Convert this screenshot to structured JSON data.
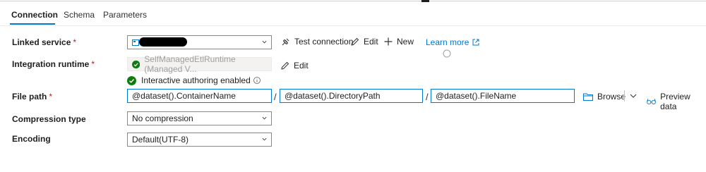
{
  "tabs": [
    {
      "label": "Connection"
    },
    {
      "label": "Schema"
    },
    {
      "label": "Parameters"
    }
  ],
  "linked_service": {
    "label": "Linked service",
    "required_mark": "*",
    "test_connection": "Test connection",
    "edit": "Edit",
    "new": "New",
    "learn_more": "Learn more"
  },
  "integration_runtime": {
    "label": "Integration runtime",
    "required_mark": "*",
    "value": "SelfManagedEtlRuntime (Managed V...",
    "edit": "Edit",
    "status": "Interactive authoring enabled"
  },
  "file_path": {
    "label": "File path",
    "required_mark": "*",
    "container": "@dataset().ContainerName",
    "directory": "@dataset().DirectoryPath",
    "file": "@dataset().FileName",
    "separator": "/",
    "browse": "Browse",
    "preview": "Preview data"
  },
  "compression": {
    "label": "Compression type",
    "value": "No compression"
  },
  "encoding": {
    "label": "Encoding",
    "value": "Default(UTF-8)"
  },
  "colors": {
    "accent": "#0078d4",
    "success": "#107c10",
    "required": "#a4262c"
  }
}
